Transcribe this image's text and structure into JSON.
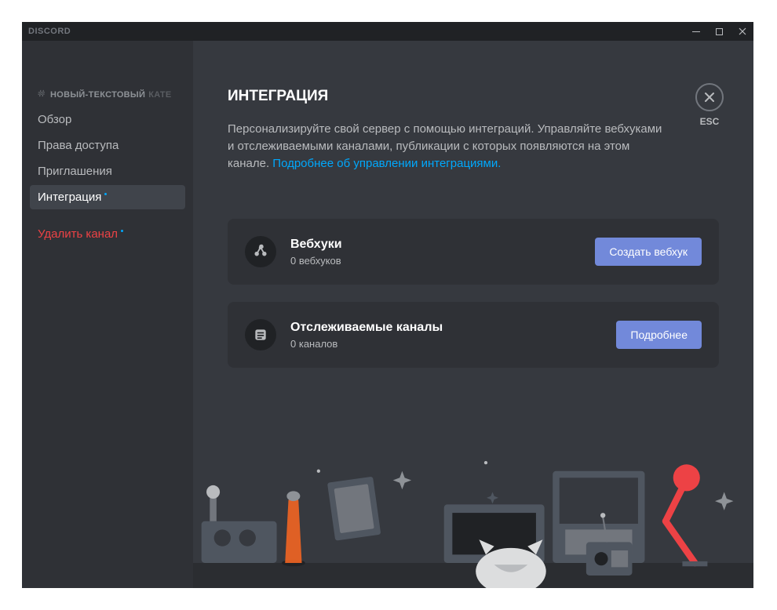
{
  "app": {
    "title": "DISCORD"
  },
  "sidebar": {
    "channel_prefix": "#",
    "channel_name": "НОВЫЙ-ТЕКСТОВЫЙ",
    "channel_category": "КАТЕ",
    "items": [
      {
        "label": "Обзор",
        "selected": false
      },
      {
        "label": "Права доступа",
        "selected": false
      },
      {
        "label": "Приглашения",
        "selected": false
      },
      {
        "label": "Интеграция",
        "selected": true
      }
    ],
    "delete_label": "Удалить канал"
  },
  "close": {
    "label": "ESC"
  },
  "page": {
    "title": "ИНТЕГРАЦИЯ",
    "description": "Персонализируйте свой сервер с помощью интеграций. Управляйте вебхуками и отслеживаемыми каналами, публикации с которых появляются на этом канале. ",
    "learn_more": "Подробнее об управлении интеграциями."
  },
  "cards": {
    "webhooks": {
      "title": "Вебхуки",
      "sub": "0 вебхуков",
      "button": "Создать вебхук"
    },
    "channels": {
      "title": "Отслеживаемые каналы",
      "sub": "0 каналов",
      "button": "Подробнее"
    }
  }
}
